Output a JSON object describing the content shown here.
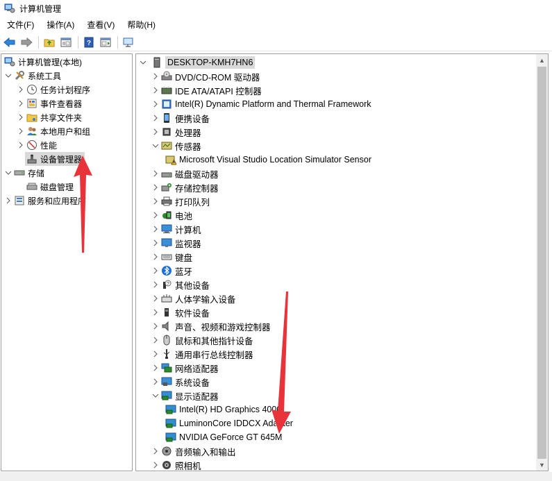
{
  "window": {
    "title": "计算机管理"
  },
  "menubar": {
    "items": [
      "文件(F)",
      "操作(A)",
      "查看(V)",
      "帮助(H)"
    ]
  },
  "toolbar": {
    "buttons": [
      "back-icon",
      "forward-icon",
      "up-folder-icon",
      "show-hide-tree-icon",
      "help-icon",
      "show-action-pane-icon",
      "monitor-icon"
    ]
  },
  "left_tree": {
    "root": "计算机管理(本地)",
    "system_tools": "系统工具",
    "task_scheduler": "任务计划程序",
    "event_viewer": "事件查看器",
    "shared_folders": "共享文件夹",
    "local_users": "本地用户和组",
    "performance": "性能",
    "device_manager": "设备管理器",
    "storage": "存储",
    "disk_management": "磁盘管理",
    "services": "服务和应用程序"
  },
  "device_tree": {
    "root": "DESKTOP-KMH7HN6",
    "categories": [
      {
        "label": "DVD/CD-ROM 驱动器",
        "icon": "dvd-drive-icon",
        "expanded": false
      },
      {
        "label": "IDE ATA/ATAPI 控制器",
        "icon": "ide-controller-icon",
        "expanded": false
      },
      {
        "label": "Intel(R) Dynamic Platform and Thermal Framework",
        "icon": "thermal-framework-icon",
        "expanded": false
      },
      {
        "label": "便携设备",
        "icon": "portable-device-icon",
        "expanded": false
      },
      {
        "label": "处理器",
        "icon": "processor-icon",
        "expanded": false
      },
      {
        "label": "传感器",
        "icon": "sensor-icon",
        "expanded": true
      },
      {
        "label": "Microsoft Visual Studio Location Simulator Sensor",
        "icon": "sensor-warning-icon",
        "child": true
      },
      {
        "label": "磁盘驱动器",
        "icon": "disk-drive-icon",
        "expanded": false
      },
      {
        "label": "存储控制器",
        "icon": "storage-controller-icon",
        "expanded": false
      },
      {
        "label": "打印队列",
        "icon": "printer-icon",
        "expanded": false
      },
      {
        "label": "电池",
        "icon": "battery-icon",
        "expanded": false
      },
      {
        "label": "计算机",
        "icon": "computer-icon",
        "expanded": false
      },
      {
        "label": "监视器",
        "icon": "monitor-icon",
        "expanded": false
      },
      {
        "label": "键盘",
        "icon": "keyboard-icon",
        "expanded": false
      },
      {
        "label": "蓝牙",
        "icon": "bluetooth-icon",
        "expanded": false
      },
      {
        "label": "其他设备",
        "icon": "other-devices-icon",
        "expanded": false
      },
      {
        "label": "人体学输入设备",
        "icon": "hid-icon",
        "expanded": false
      },
      {
        "label": "软件设备",
        "icon": "software-device-icon",
        "expanded": false
      },
      {
        "label": "声音、视频和游戏控制器",
        "icon": "audio-icon",
        "expanded": false
      },
      {
        "label": "鼠标和其他指针设备",
        "icon": "mouse-icon",
        "expanded": false
      },
      {
        "label": "通用串行总线控制器",
        "icon": "usb-icon",
        "expanded": false
      },
      {
        "label": "网络适配器",
        "icon": "network-adapter-icon",
        "expanded": false
      },
      {
        "label": "系统设备",
        "icon": "system-device-icon",
        "expanded": false
      },
      {
        "label": "显示适配器",
        "icon": "display-adapter-icon",
        "expanded": true
      },
      {
        "label": "Intel(R) HD Graphics 4000",
        "icon": "display-adapter-icon",
        "child": true
      },
      {
        "label": "LuminonCore IDDCX Adapter",
        "icon": "display-adapter-icon",
        "child": true
      },
      {
        "label": "NVIDIA GeForce GT 645M",
        "icon": "display-adapter-icon",
        "child": true
      },
      {
        "label": "音频输入和输出",
        "icon": "audio-io-icon",
        "expanded": false
      },
      {
        "label": "照相机",
        "icon": "camera-icon",
        "expanded": false
      }
    ]
  },
  "colors": {
    "selection": "#d9d9d9",
    "annotation_arrow": "#e8333a",
    "pane_border": "#a0a0a0",
    "scroll_thumb": "#c2c2c2"
  }
}
